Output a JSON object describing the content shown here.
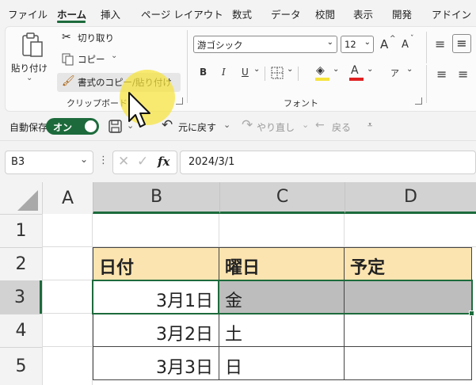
{
  "tabs": [
    "ファイル",
    "ホーム",
    "挿入",
    "ページ レイアウト",
    "数式",
    "データ",
    "校閲",
    "表示",
    "開発",
    "アドイン"
  ],
  "clipboard": {
    "paste": "貼り付け",
    "cut": "切り取り",
    "copy": "コピー",
    "format_painter": "書式のコピー/貼り付け",
    "group": "クリップボード"
  },
  "font": {
    "name": "游ゴシック",
    "size": "12",
    "group": "フォント",
    "bold": "B",
    "italic": "I",
    "underline": "U",
    "grow": "A",
    "shrink": "A",
    "color_a": "A",
    "phonetic": "ア"
  },
  "qat": {
    "autosave_label": "自動保存",
    "autosave_state": "オン",
    "undo": "元に戻す",
    "redo": "やり直し",
    "back": "戻る"
  },
  "formula_bar": {
    "name_box": "B3",
    "fx": "fx",
    "formula": "2024/3/1"
  },
  "sheet": {
    "columns": [
      "A",
      "B",
      "C",
      "D"
    ],
    "rows": [
      "1",
      "2",
      "3",
      "4",
      "5"
    ],
    "headers": [
      "日付",
      "曜日",
      "予定"
    ],
    "data": [
      {
        "date": "3月1日",
        "day": "金",
        "plan": ""
      },
      {
        "date": "3月2日",
        "day": "土",
        "plan": ""
      },
      {
        "date": "3月3日",
        "day": "日",
        "plan": ""
      }
    ]
  },
  "colors": {
    "accent": "#1d6b3c",
    "header_fill": "#fce4b0",
    "selection_fill": "#bdbdbd",
    "highlight": "#f6e33c"
  }
}
